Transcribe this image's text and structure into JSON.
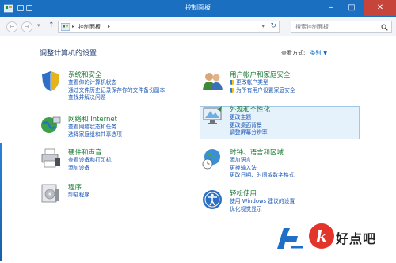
{
  "window": {
    "title": "控制面板"
  },
  "address": {
    "crumb": "控制面板",
    "search_placeholder": "搜索控制面板"
  },
  "main": {
    "heading": "调整计算机的设置",
    "view_by_label": "查看方式:",
    "view_by_value": "类别"
  },
  "categories": {
    "system_security": {
      "title": "系统和安全",
      "links": [
        "查看你的计算机状态",
        "通过文件历史记录保存你的文件备份副本",
        "查找并解决问题"
      ]
    },
    "network": {
      "title": "网络和 Internet",
      "links": [
        "查看网络状态和任务",
        "选择家庭组和共享选项"
      ]
    },
    "hardware": {
      "title": "硬件和声音",
      "links": [
        "查看设备和打印机",
        "添加设备"
      ]
    },
    "programs": {
      "title": "程序",
      "links": [
        "卸载程序"
      ]
    },
    "user_accounts": {
      "title": "用户帐户和家庭安全",
      "links": [
        "更改帐户类型",
        "为所有用户设置家庭安全"
      ]
    },
    "appearance": {
      "title": "外观和个性化",
      "links": [
        "更改主题",
        "更改桌面背景",
        "调整屏幕分辨率"
      ]
    },
    "clock_region": {
      "title": "时钟、语言和区域",
      "links": [
        "添加语言",
        "更换输入法",
        "更改日期、时间或数字格式"
      ]
    },
    "ease": {
      "title": "轻松使用",
      "links": [
        "使用 Windows 建议的设置",
        "优化视觉显示"
      ]
    }
  },
  "watermark": {
    "text": "好点吧"
  },
  "colors": {
    "titlebar": "#1b6fc0",
    "category": "#1b7a34",
    "link": "#1a56b5"
  }
}
